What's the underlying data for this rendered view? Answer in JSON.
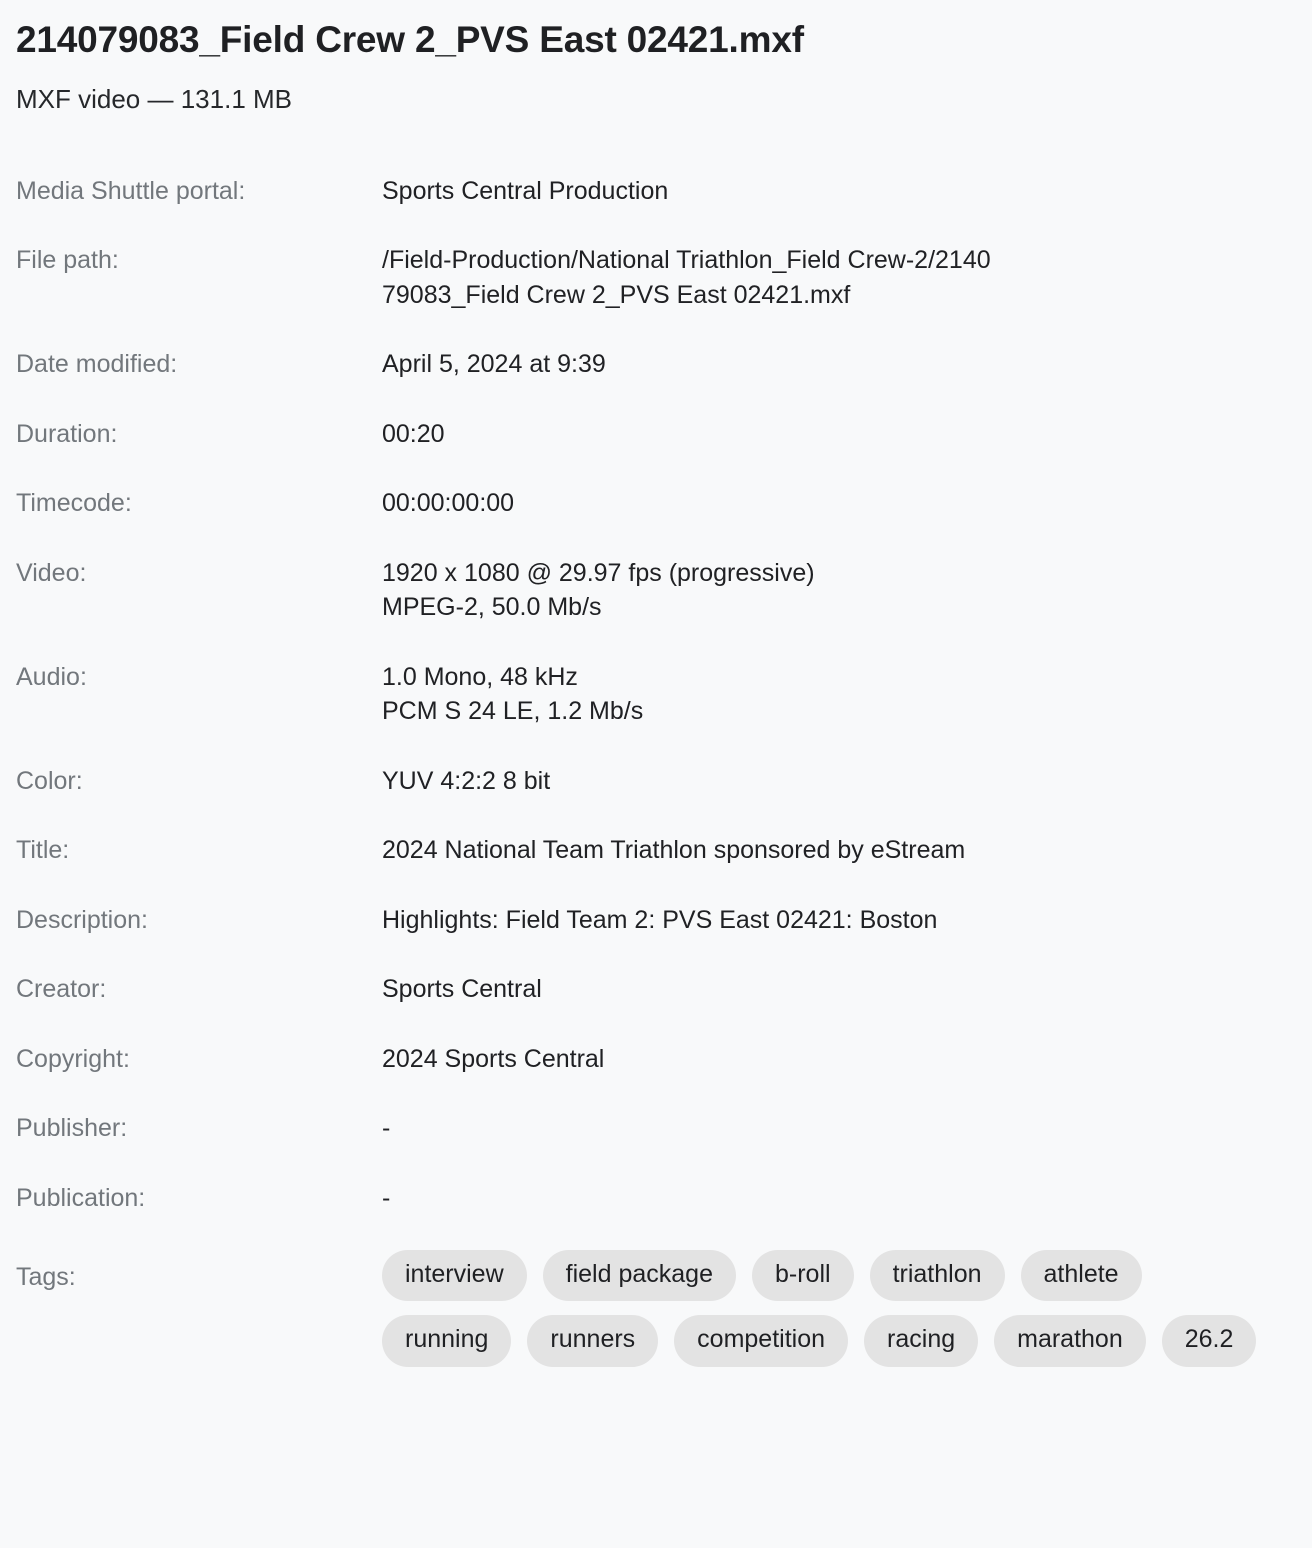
{
  "header": {
    "file_name": "214079083_Field Crew 2_PVS East 02421.mxf",
    "file_summary": "MXF video — 131.1 MB"
  },
  "metadata": {
    "rows": [
      {
        "label": "Media Shuttle portal:",
        "lines": [
          "Sports Central Production"
        ]
      },
      {
        "label": "File path:",
        "lines": [
          "/Field-Production/National Triathlon_Field Crew-2/2140",
          "79083_Field Crew 2_PVS East 02421.mxf"
        ]
      },
      {
        "label": "Date modified:",
        "lines": [
          "April 5, 2024 at 9:39"
        ]
      },
      {
        "label": "Duration:",
        "lines": [
          "00:20"
        ]
      },
      {
        "label": "Timecode:",
        "lines": [
          "00:00:00:00"
        ]
      },
      {
        "label": "Video:",
        "lines": [
          "1920 x 1080 @ 29.97 fps (progressive)",
          "MPEG-2, 50.0 Mb/s"
        ]
      },
      {
        "label": "Audio:",
        "lines": [
          "1.0 Mono, 48 kHz",
          "PCM S 24 LE, 1.2 Mb/s"
        ]
      },
      {
        "label": "Color:",
        "lines": [
          "YUV 4:2:2 8 bit"
        ]
      },
      {
        "label": "Title:",
        "lines": [
          "2024 National Team Triathlon sponsored by eStream"
        ]
      },
      {
        "label": "Description:",
        "lines": [
          "Highlights: Field Team 2: PVS East 02421: Boston"
        ]
      },
      {
        "label": "Creator:",
        "lines": [
          "Sports Central"
        ]
      },
      {
        "label": "Copyright:",
        "lines": [
          "2024 Sports Central"
        ]
      },
      {
        "label": "Publisher:",
        "lines": [
          "-"
        ]
      },
      {
        "label": "Publication:",
        "lines": [
          "-"
        ]
      }
    ],
    "tags_label": "Tags:",
    "tags": [
      "interview",
      "field package",
      "b-roll",
      "triathlon",
      "athlete",
      "running",
      "runners",
      "competition",
      "racing",
      "marathon",
      "26.2"
    ]
  },
  "colors": {
    "background": "#f8f9fa",
    "label_text": "#72777c",
    "value_text": "#202124",
    "tag_background": "#e3e3e3"
  }
}
